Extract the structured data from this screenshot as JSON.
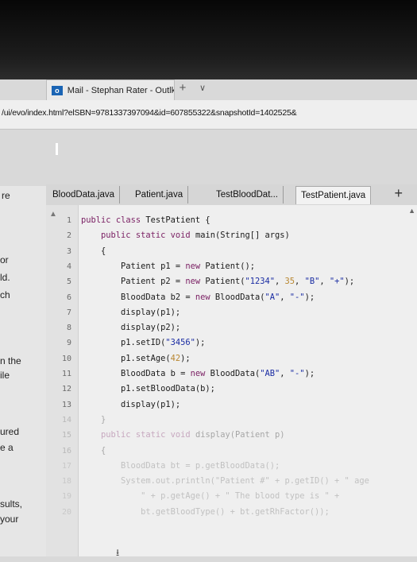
{
  "browser": {
    "tab_title": "Mail - Stephan Rater - Outlk",
    "tab_icon": "outlook-icon",
    "url": "/ui/evo/index.html?elSBN=9781337397094&id=607855322&snapshotId=1402525&"
  },
  "left_panel": {
    "fragments": [
      "re",
      "or",
      "ld.",
      "ch",
      "n the",
      "ile",
      "ured",
      "e a",
      "sults,",
      "your"
    ]
  },
  "editor_tabs": [
    {
      "label": "BloodData.java",
      "active": false
    },
    {
      "label": "Patient.java",
      "active": false
    },
    {
      "label": "TestBloodDat...",
      "active": false
    },
    {
      "label": "TestPatient.java",
      "active": true
    }
  ],
  "add_tab_label": "+",
  "code": {
    "line_numbers": [
      "1",
      "2",
      "3",
      "4",
      "5",
      "6",
      "7",
      "8",
      "9",
      "10",
      "11",
      "12",
      "13",
      "14",
      "15",
      "16",
      "17",
      "18",
      "19",
      "20"
    ],
    "lines": [
      [
        {
          "k": "kw",
          "t": "public"
        },
        {
          "t": " "
        },
        {
          "k": "kw",
          "t": "class"
        },
        {
          "t": " TestPatient {"
        }
      ],
      [
        {
          "t": "    "
        },
        {
          "k": "kw",
          "t": "public"
        },
        {
          "t": " "
        },
        {
          "k": "kw",
          "t": "static"
        },
        {
          "t": " "
        },
        {
          "k": "kw",
          "t": "void"
        },
        {
          "t": " main(String[] args)"
        }
      ],
      [
        {
          "t": "    {"
        }
      ],
      [
        {
          "t": "        Patient p1 = "
        },
        {
          "k": "kw",
          "t": "new"
        },
        {
          "t": " Patient();"
        }
      ],
      [
        {
          "t": "        Patient p2 = "
        },
        {
          "k": "kw",
          "t": "new"
        },
        {
          "t": " Patient("
        },
        {
          "k": "str",
          "t": "\"1234\""
        },
        {
          "t": ", "
        },
        {
          "k": "num",
          "t": "35"
        },
        {
          "t": ", "
        },
        {
          "k": "str",
          "t": "\"B\""
        },
        {
          "t": ", "
        },
        {
          "k": "str",
          "t": "\"+\""
        },
        {
          "t": ");"
        }
      ],
      [
        {
          "t": "        BloodData b2 = "
        },
        {
          "k": "kw",
          "t": "new"
        },
        {
          "t": " BloodData("
        },
        {
          "k": "str",
          "t": "\"A\""
        },
        {
          "t": ", "
        },
        {
          "k": "str",
          "t": "\"-\""
        },
        {
          "t": ");"
        }
      ],
      [
        {
          "t": "        display(p1);"
        }
      ],
      [
        {
          "t": "        display(p2);"
        }
      ],
      [
        {
          "t": "        p1.setID("
        },
        {
          "k": "str",
          "t": "\"3456\""
        },
        {
          "t": ");"
        }
      ],
      [
        {
          "t": "        p1.setAge("
        },
        {
          "k": "num",
          "t": "42"
        },
        {
          "t": ");"
        }
      ],
      [
        {
          "t": "        BloodData b = "
        },
        {
          "k": "kw",
          "t": "new"
        },
        {
          "t": " BloodData("
        },
        {
          "k": "str",
          "t": "\"AB\""
        },
        {
          "t": ", "
        },
        {
          "k": "str",
          "t": "\"-\""
        },
        {
          "t": ");"
        }
      ],
      [
        {
          "t": "        p1.setBloodData(b);"
        }
      ],
      [
        {
          "t": "        display(p1);"
        }
      ],
      [
        {
          "t": "    }"
        }
      ],
      [
        {
          "t": "    "
        },
        {
          "k": "kw",
          "t": "public"
        },
        {
          "t": " "
        },
        {
          "k": "kw",
          "t": "static"
        },
        {
          "t": " "
        },
        {
          "k": "kw",
          "t": "void"
        },
        {
          "t": " display(Patient p)"
        }
      ],
      [
        {
          "t": "    {"
        }
      ],
      [
        {
          "t": "        BloodData bt = p.getBloodData();"
        }
      ],
      [
        {
          "t": "        System.out.println(\"Patient #\" + p.getID() + \" age"
        }
      ],
      [
        {
          "t": "            \" + p.getAge() + \" The blood type is \" +"
        }
      ],
      [
        {
          "t": "            bt.getBloodType() + bt.getRhFactor());"
        }
      ]
    ]
  },
  "colors": {
    "keyword": "#7a1f63",
    "string": "#1a2ca3",
    "number": "#b8862f",
    "text": "#1a1a1a"
  }
}
